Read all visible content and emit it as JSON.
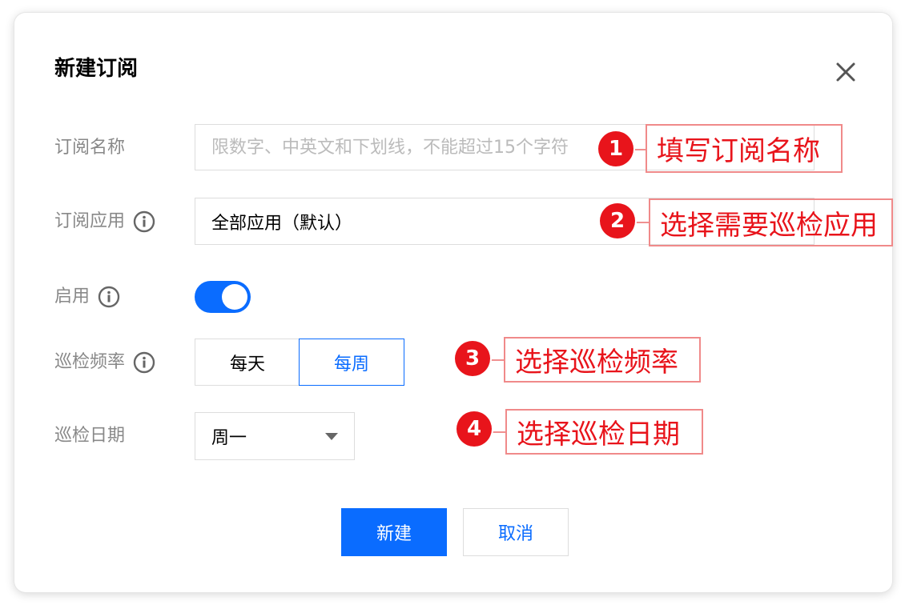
{
  "dialog": {
    "title": "新建订阅",
    "close_icon": "close-icon"
  },
  "form": {
    "name": {
      "label": "订阅名称",
      "placeholder": "限数字、中英文和下划线，不能超过15个字符",
      "value": ""
    },
    "app": {
      "label": "订阅应用",
      "icon": "info-icon",
      "value": "全部应用（默认）"
    },
    "enabled": {
      "label": "启用",
      "icon": "info-icon",
      "on": true
    },
    "frequency": {
      "label": "巡检频率",
      "icon": "info-icon",
      "options": [
        "每天",
        "每周"
      ],
      "selected": "每周"
    },
    "date": {
      "label": "巡检日期",
      "value": "周一"
    }
  },
  "buttons": {
    "create": "新建",
    "cancel": "取消"
  },
  "annotations": [
    {
      "number": "1",
      "text": "填写订阅名称"
    },
    {
      "number": "2",
      "text": "选择需要巡检应用"
    },
    {
      "number": "3",
      "text": "选择巡检频率"
    },
    {
      "number": "4",
      "text": "选择巡检日期"
    }
  ],
  "colors": {
    "primary": "#0a6cff",
    "annotation": "#e8141b",
    "label": "#888888"
  }
}
